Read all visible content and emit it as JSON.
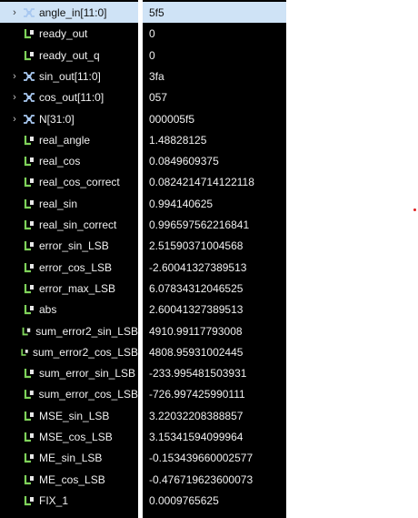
{
  "colors": {
    "signal_icon": "#7fd35a",
    "bus_icon": "#a8c8f0",
    "selected_row": "#cfe3f6"
  },
  "signals": [
    {
      "name": "angle_in[11:0]",
      "value": "5f5",
      "icon": "bus-signal-icon",
      "expandable": true,
      "selected": true
    },
    {
      "name": "ready_out",
      "value": "0",
      "icon": "signal-icon",
      "expandable": false
    },
    {
      "name": "ready_out_q",
      "value": "0",
      "icon": "signal-icon",
      "expandable": false
    },
    {
      "name": "sin_out[11:0]",
      "value": "3fa",
      "icon": "bus-signal-icon",
      "expandable": true
    },
    {
      "name": "cos_out[11:0]",
      "value": "057",
      "icon": "bus-signal-icon",
      "expandable": true
    },
    {
      "name": "N[31:0]",
      "value": "000005f5",
      "icon": "bus-signal-icon",
      "expandable": true
    },
    {
      "name": "real_angle",
      "value": "1.48828125",
      "icon": "signal-icon",
      "expandable": false
    },
    {
      "name": "real_cos",
      "value": "0.0849609375",
      "icon": "signal-icon",
      "expandable": false
    },
    {
      "name": "real_cos_correct",
      "value": "0.0824214714122118",
      "icon": "signal-icon",
      "expandable": false
    },
    {
      "name": "real_sin",
      "value": "0.994140625",
      "icon": "signal-icon",
      "expandable": false
    },
    {
      "name": "real_sin_correct",
      "value": "0.996597562216841",
      "icon": "signal-icon",
      "expandable": false
    },
    {
      "name": "error_sin_LSB",
      "value": "2.51590371004568",
      "icon": "signal-icon",
      "expandable": false
    },
    {
      "name": "error_cos_LSB",
      "value": "-2.60041327389513",
      "icon": "signal-icon",
      "expandable": false
    },
    {
      "name": "error_max_LSB",
      "value": "6.07834312046525",
      "icon": "signal-icon",
      "expandable": false
    },
    {
      "name": "abs",
      "value": "2.60041327389513",
      "icon": "signal-icon",
      "expandable": false
    },
    {
      "name": "sum_error2_sin_LSB",
      "value": "4910.99117793008",
      "icon": "signal-icon",
      "expandable": false
    },
    {
      "name": "sum_error2_cos_LSB",
      "value": "4808.95931002445",
      "icon": "signal-icon",
      "expandable": false
    },
    {
      "name": "sum_error_sin_LSB",
      "value": "-233.995481503931",
      "icon": "signal-icon",
      "expandable": false
    },
    {
      "name": "sum_error_cos_LSB",
      "value": "-726.997425990111",
      "icon": "signal-icon",
      "expandable": false
    },
    {
      "name": "MSE_sin_LSB",
      "value": "3.22032208388857",
      "icon": "signal-icon",
      "expandable": false
    },
    {
      "name": "MSE_cos_LSB",
      "value": "3.15341594099964",
      "icon": "signal-icon",
      "expandable": false
    },
    {
      "name": "ME_sin_LSB",
      "value": "-0.153439660002577",
      "icon": "signal-icon",
      "expandable": false
    },
    {
      "name": "ME_cos_LSB",
      "value": "-0.476719623600073",
      "icon": "signal-icon",
      "expandable": false
    },
    {
      "name": "FIX_1",
      "value": "0.0009765625",
      "icon": "signal-icon",
      "expandable": false
    }
  ]
}
